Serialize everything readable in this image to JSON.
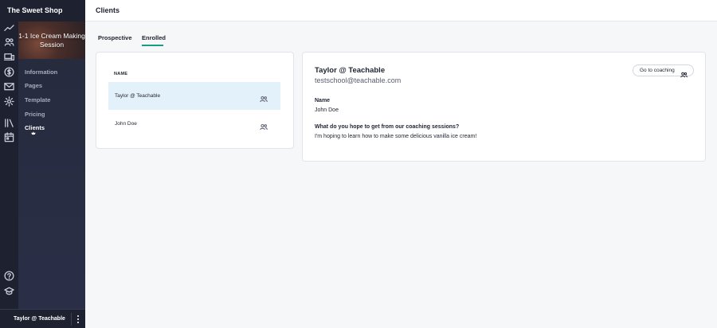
{
  "app": {
    "school_name": "The Sweet Shop"
  },
  "rail": {
    "icons": [
      "trend-icon",
      "users-icon",
      "devices-icon",
      "dollar-icon",
      "mail-icon",
      "gear-icon",
      "library-icon",
      "calendar-icon",
      "help-icon",
      "graduation-cap-icon"
    ]
  },
  "sidebar": {
    "course_title": "1-1 Ice Cream Making Session",
    "items": [
      {
        "label": "Information"
      },
      {
        "label": "Pages"
      },
      {
        "label": "Template"
      },
      {
        "label": "Pricing"
      },
      {
        "label": "Clients"
      }
    ],
    "active_item": "Clients"
  },
  "user": {
    "name": "Taylor @ Teachable"
  },
  "header": {
    "title": "Clients"
  },
  "tabs": [
    {
      "label": "Prospective"
    },
    {
      "label": "Enrolled"
    }
  ],
  "active_tab": "Enrolled",
  "client_list": {
    "header": "NAME",
    "rows": [
      {
        "name": "Taylor @ Teachable"
      },
      {
        "name": "John Doe"
      }
    ],
    "selected_row": "Taylor @ Teachable"
  },
  "detail": {
    "name": "Taylor @ Teachable",
    "email": "testschool@teachable.com",
    "coaching_button": "Go to coaching",
    "fields": [
      {
        "label": "Name",
        "value": "John Doe"
      },
      {
        "label": "What do you hope to get from our coaching sessions?",
        "value": "I'm hoping to learn how to make some delicious vanilla ice cream!"
      }
    ]
  },
  "colors": {
    "accent": "#1a9c84",
    "sidebar_bg": "#262a3c",
    "selected_row_bg": "#e3f1fb"
  }
}
